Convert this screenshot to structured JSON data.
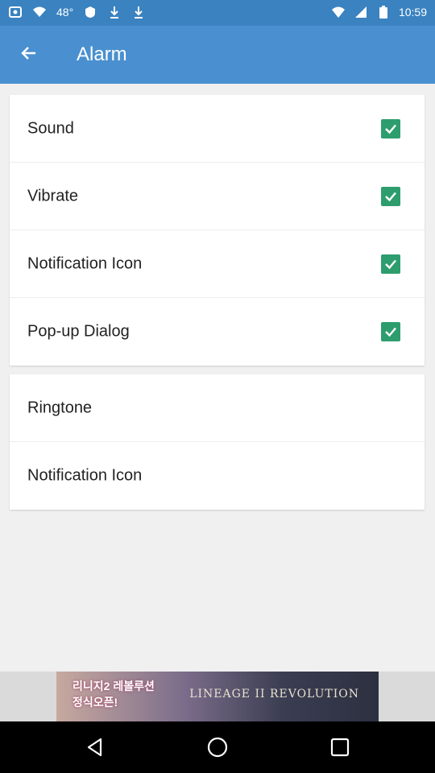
{
  "status_bar": {
    "network": "48°",
    "time": "10:59"
  },
  "app_bar": {
    "title": "Alarm"
  },
  "settings_checked": [
    {
      "label": "Sound",
      "checked": true
    },
    {
      "label": "Vibrate",
      "checked": true
    },
    {
      "label": "Notification Icon",
      "checked": true
    },
    {
      "label": "Pop-up Dialog",
      "checked": true
    }
  ],
  "settings_plain": [
    {
      "label": "Ringtone"
    },
    {
      "label": "Notification Icon"
    }
  ],
  "ad": {
    "text_line1": "리니지2 레볼루션",
    "text_line2": "정식오픈!",
    "logo": "LINEAGE II REVOLUTION"
  },
  "colors": {
    "status_bar": "#3a82c0",
    "app_bar": "#4a90d0",
    "checkbox": "#2e9d6e"
  }
}
